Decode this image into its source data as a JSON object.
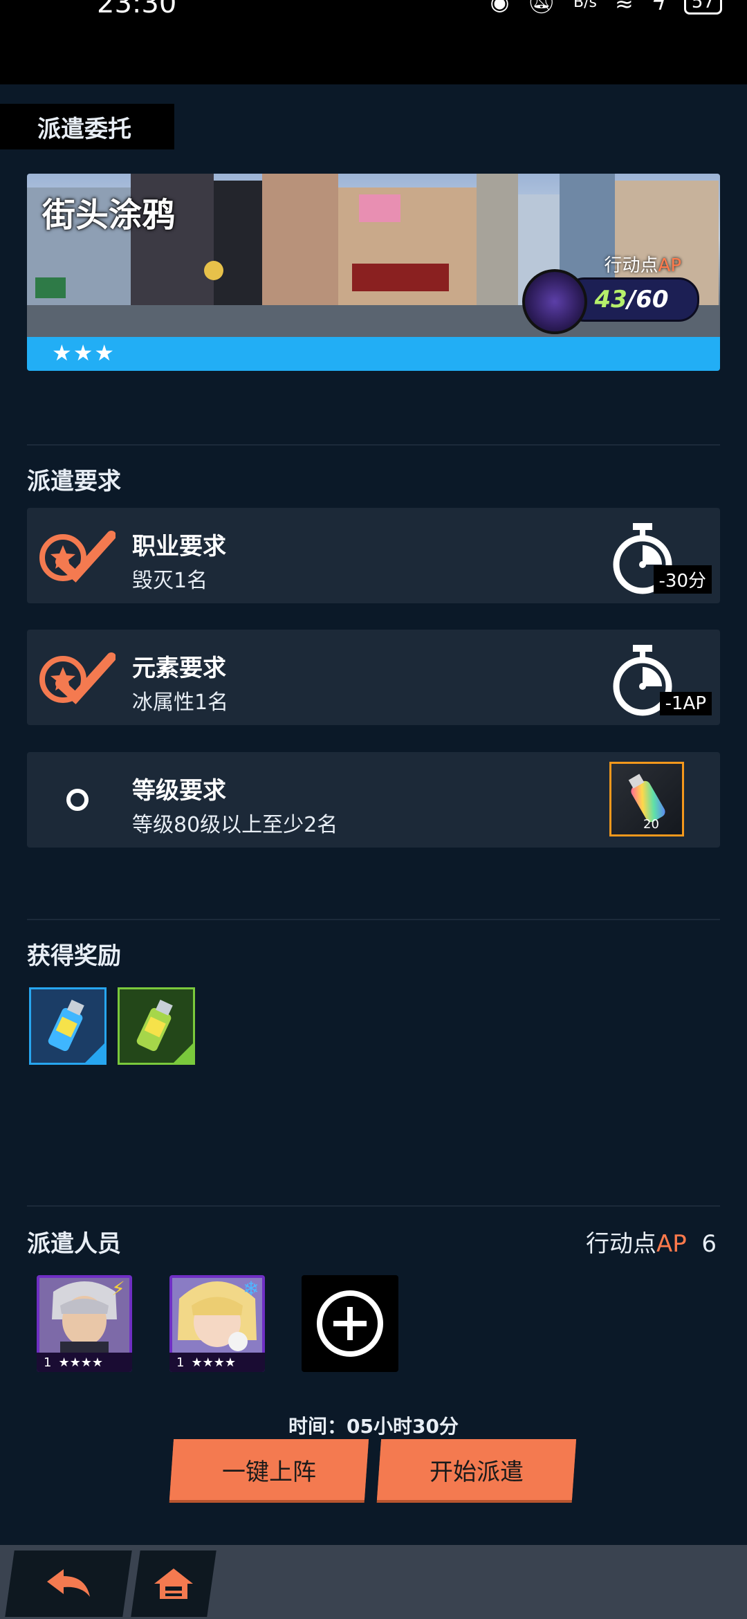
{
  "status_bar": {
    "time": "23:30",
    "net_speed": "B/s",
    "battery": "57"
  },
  "header": {
    "title": "派遣委托"
  },
  "mission": {
    "name": "街头涂鸦",
    "stars": "★★★",
    "ap_label_prefix": "行动点",
    "ap_label_accent": "AP",
    "ap_current": "43",
    "ap_max": "/60"
  },
  "requirements": {
    "title": "派遣要求",
    "items": [
      {
        "title": "职业要求",
        "desc": "毁灭1名",
        "met": true,
        "bonus": "-30分"
      },
      {
        "title": "元素要求",
        "desc": "冰属性1名",
        "met": true,
        "bonus": "-1AP"
      },
      {
        "title": "等级要求",
        "desc": "等级80级以上至少2名",
        "met": false,
        "item_count": "20"
      }
    ]
  },
  "rewards": {
    "title": "获得奖励"
  },
  "dispatch": {
    "title": "派遣人员",
    "ap_prefix": "行动点",
    "ap_accent": "AP",
    "ap_cost": "6",
    "members": [
      {
        "level": "1",
        "stars": "★★★★",
        "element": "⚡"
      },
      {
        "level": "1",
        "stars": "★★★★",
        "element": "❄"
      }
    ],
    "time_label": "时间：05小时30分"
  },
  "buttons": {
    "quick_deploy": "一键上阵",
    "start_dispatch": "开始派遣"
  },
  "colors": {
    "accent": "#f47a50",
    "banner_bar": "#22aef5",
    "background": "#0b1928"
  }
}
